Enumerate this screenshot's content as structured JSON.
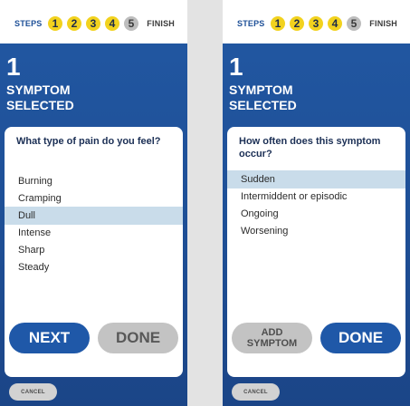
{
  "steps_label": "STEPS",
  "finish_label": "FINISH",
  "steps": [
    "1",
    "2",
    "3",
    "4",
    "5"
  ],
  "colors": {
    "brand_blue": "#1f58a8",
    "step_active": "#f2d21e",
    "step_inactive": "#bdbdbd",
    "selected_row": "#c9dcea"
  },
  "left": {
    "count": "1",
    "count_label_line1": "SYMPTOM",
    "count_label_line2": "SELECTED",
    "question": "What type of pain do you feel?",
    "options": [
      "Burning",
      "Cramping",
      "Dull",
      "Intense",
      "Sharp",
      "Steady"
    ],
    "selected_option": "Dull",
    "next_label": "NEXT",
    "done_label": "DONE",
    "cancel_label": "CANCEL"
  },
  "right": {
    "count": "1",
    "count_label_line1": "SYMPTOM",
    "count_label_line2": "SELECTED",
    "question": "How often does this symptom occur?",
    "options": [
      "Sudden",
      "Intermiddent or episodic",
      "Ongoing",
      "Worsening"
    ],
    "selected_option": "Sudden",
    "add_label_line1": "ADD",
    "add_label_line2": "SYMPTOM",
    "done_label": "DONE",
    "cancel_label": "CANCEL"
  }
}
